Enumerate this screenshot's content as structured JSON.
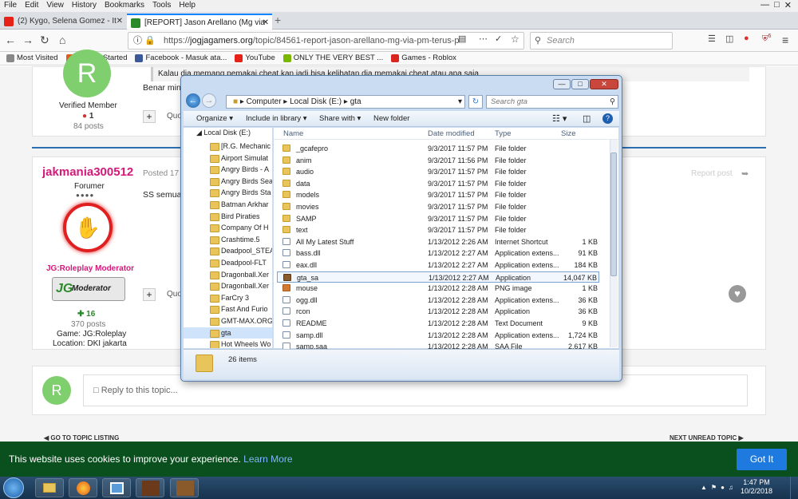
{
  "firefox": {
    "menu": [
      "File",
      "Edit",
      "View",
      "History",
      "Bookmarks",
      "Tools",
      "Help"
    ],
    "tabs": [
      {
        "title": "(2) Kygo, Selena Gomez - It",
        "color": "#e62117"
      },
      {
        "title": "[REPORT] Jason Arellano (Mg via",
        "color": "#2a8a2a"
      }
    ],
    "url_prefix": "https://",
    "url_host": "jogjagamers.org",
    "url_path": "/topic/84561-report-jason-arellano-mg-via-pm-terus-p",
    "search_placeholder": "Search",
    "badge_count": "6",
    "bookmarks": [
      {
        "label": "Most Visited",
        "color": "#888"
      },
      {
        "label": "Getting Started",
        "color": "#e25a1c"
      },
      {
        "label": "Facebook - Masuk ata...",
        "color": "#3b5998"
      },
      {
        "label": "YouTube",
        "color": "#e62117"
      },
      {
        "label": "ONLY THE VERY BEST ...",
        "color": "#7ab800"
      },
      {
        "label": "Games - Roblox",
        "color": "#d9251d"
      }
    ]
  },
  "forum": {
    "post1": {
      "avatar_letter": "R",
      "role": "Verified Member",
      "rep": "1",
      "posts": "84 posts",
      "quote_lines": [
        "Kalau dia memang pemakai cheat kan jadi bisa kelihatan dia memakai cheat atau apa saja"
      ],
      "body": "Benar min",
      "quote_label": "Quo"
    },
    "post2": {
      "username": "jakmania300512",
      "posted": "Posted 17 h",
      "role": "Forumer",
      "mod_title": "JG:Roleplay Moderator",
      "badge_text": "Moderator",
      "rep": "16",
      "posts": "370 posts",
      "game": "Game: JG:Roleplay",
      "location": "Location: DKI jakarta",
      "body": "SS semua",
      "quote_label": "Quo",
      "report": "Report post"
    },
    "reply": {
      "avatar_letter": "R",
      "placeholder": "Reply to this topic..."
    },
    "nav_prev": "GO TO TOPIC LISTING",
    "nav_next": "NEXT UNREAD TOPIC"
  },
  "cookie": {
    "text": "This website uses cookies to improve your experience.",
    "learn_more": "Learn More",
    "button": "Got It"
  },
  "explorer": {
    "breadcrumb": [
      "Computer",
      "Local Disk (E:)",
      "gta"
    ],
    "search_placeholder": "Search gta",
    "toolbar": {
      "organize": "Organize",
      "include": "Include in library",
      "share": "Share with",
      "new_folder": "New folder"
    },
    "nav_root": "Local Disk (E:)",
    "nav_items": [
      "[R.G. Mechanic",
      "Airport Simulat",
      "Angry Birds - A",
      "Angry Birds Sea",
      "Angry Birds Sta",
      "Batman Arkhar",
      "Bird Piraties",
      "Company Of H",
      "Crashtime.5",
      "Deadpool_STEA",
      "Deadpool-FLT",
      "Dragonball.Xer",
      "Dragonball.Xer",
      "FarCry 3",
      "Fast And Furio",
      "GMT-MAX.ORG",
      "gta",
      "Hot Wheels Wo"
    ],
    "columns": {
      "name": "Name",
      "date": "Date modified",
      "type": "Type",
      "size": "Size"
    },
    "files": [
      {
        "name": "_gcafepro",
        "date": "9/3/2017 11:57 PM",
        "type": "File folder",
        "size": "",
        "icon": "folder"
      },
      {
        "name": "anim",
        "date": "9/3/2017 11:56 PM",
        "type": "File folder",
        "size": "",
        "icon": "folder"
      },
      {
        "name": "audio",
        "date": "9/3/2017 11:57 PM",
        "type": "File folder",
        "size": "",
        "icon": "folder"
      },
      {
        "name": "data",
        "date": "9/3/2017 11:57 PM",
        "type": "File folder",
        "size": "",
        "icon": "folder"
      },
      {
        "name": "models",
        "date": "9/3/2017 11:57 PM",
        "type": "File folder",
        "size": "",
        "icon": "folder"
      },
      {
        "name": "movies",
        "date": "9/3/2017 11:57 PM",
        "type": "File folder",
        "size": "",
        "icon": "folder"
      },
      {
        "name": "SAMP",
        "date": "9/3/2017 11:57 PM",
        "type": "File folder",
        "size": "",
        "icon": "folder"
      },
      {
        "name": "text",
        "date": "9/3/2017 11:57 PM",
        "type": "File folder",
        "size": "",
        "icon": "folder"
      },
      {
        "name": "All My Latest Stuff",
        "date": "1/13/2012 2:26 AM",
        "type": "Internet Shortcut",
        "size": "1 KB",
        "icon": "file"
      },
      {
        "name": "bass.dll",
        "date": "1/13/2012 2:27 AM",
        "type": "Application extens...",
        "size": "91 KB",
        "icon": "file"
      },
      {
        "name": "eax.dll",
        "date": "1/13/2012 2:27 AM",
        "type": "Application extens...",
        "size": "184 KB",
        "icon": "file"
      },
      {
        "name": "gta_sa",
        "date": "1/13/2012 2:27 AM",
        "type": "Application",
        "size": "14,047 KB",
        "icon": "app"
      },
      {
        "name": "mouse",
        "date": "1/13/2012 2:28 AM",
        "type": "PNG image",
        "size": "1 KB",
        "icon": "png"
      },
      {
        "name": "ogg.dll",
        "date": "1/13/2012 2:28 AM",
        "type": "Application extens...",
        "size": "36 KB",
        "icon": "file"
      },
      {
        "name": "rcon",
        "date": "1/13/2012 2:28 AM",
        "type": "Application",
        "size": "36 KB",
        "icon": "file"
      },
      {
        "name": "README",
        "date": "1/13/2012 2:28 AM",
        "type": "Text Document",
        "size": "9 KB",
        "icon": "file"
      },
      {
        "name": "samp.dll",
        "date": "1/13/2012 2:28 AM",
        "type": "Application extens...",
        "size": "1,724 KB",
        "icon": "file"
      },
      {
        "name": "samp.saa",
        "date": "1/13/2012 2:28 AM",
        "type": "SAA File",
        "size": "2,617 KB",
        "icon": "file"
      }
    ],
    "selected_file": "gta_sa",
    "status": "26 items"
  },
  "taskbar": {
    "time": "1:47 PM",
    "date": "10/2/2018"
  }
}
